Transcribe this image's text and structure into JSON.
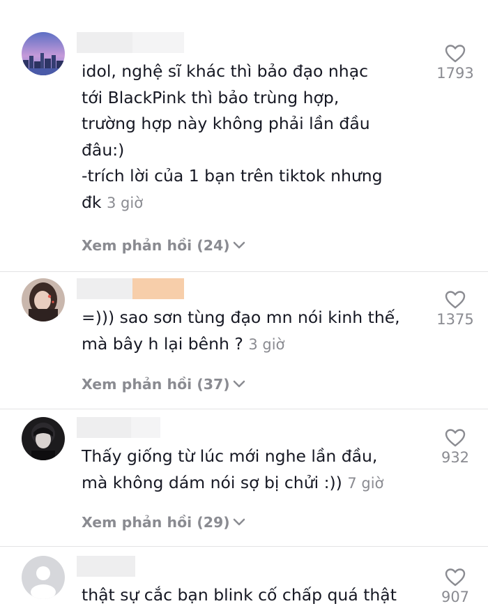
{
  "comments": [
    {
      "text": "idol, nghệ sĩ khác thì bảo đạo nhạc\ntới BlackPink thì bảo trùng hợp,\ntrường hợp này không phải lần đầu\nđâu:)\n-trích lời của 1 bạn trên tiktok nhưng\nđk",
      "time": "3 giờ",
      "replies": "Xem phản hồi (24)",
      "likes": "1793",
      "avatar_icon": "city-skyline-photo"
    },
    {
      "text": "=))) sao sơn tùng đạo mn nói kinh thế,\nmà bây h lại bênh ?",
      "time": "3 giờ",
      "replies": "Xem phản hồi (37)",
      "likes": "1375",
      "avatar_icon": "girl-portrait-photo"
    },
    {
      "text": "Thấy giống từ lúc mới nghe lần đầu,\nmà không dám nói sợ bị chửi :))",
      "time": "7 giờ",
      "replies": "Xem phản hồi (29)",
      "likes": "932",
      "avatar_icon": "boy-portrait-photo"
    },
    {
      "text": "thật sự cắc bạn blink cố chấp quá thật",
      "likes": "907",
      "avatar_icon": "default-user-icon"
    }
  ],
  "colors": {
    "text": "#161823",
    "muted": "#8a8b91",
    "name_redaction_gray": "#eeeeef",
    "name_redaction_peach": "#f7ceaa"
  },
  "icons": {
    "like": "heart-outline-icon",
    "expand": "chevron-down-icon"
  }
}
